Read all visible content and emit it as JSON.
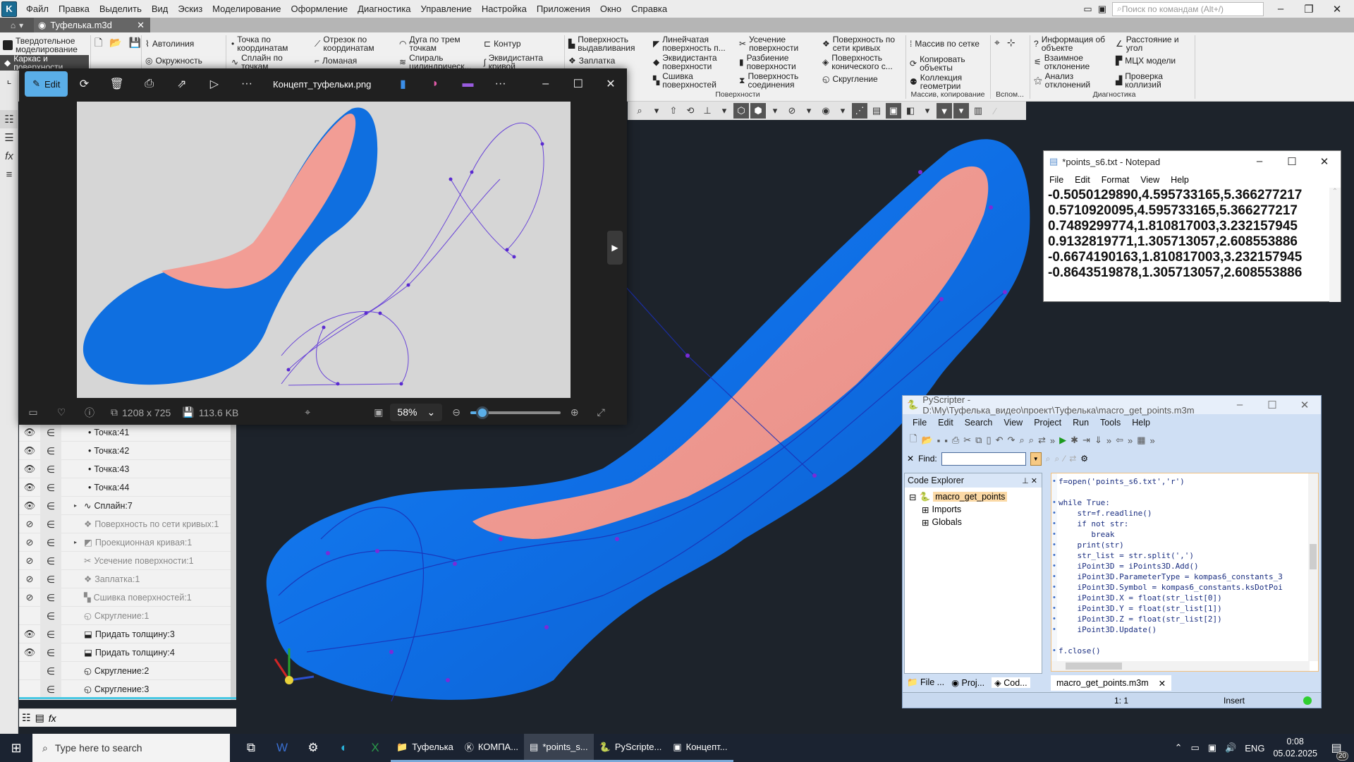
{
  "kompas": {
    "menu": [
      "Файл",
      "Правка",
      "Выделить",
      "Вид",
      "Эскиз",
      "Моделирование",
      "Оформление",
      "Диагностика",
      "Управление",
      "Настройка",
      "Приложения",
      "Окно",
      "Справка"
    ],
    "search_placeholder": "Поиск по командам (Alt+/)",
    "document_tab": "Туфелька.m3d",
    "modes": {
      "solid": "Твердотельное моделирование",
      "surface": "Каркас и поверхности"
    },
    "ribbon": {
      "sketch_tools": [
        "Автолиния",
        "Окружность",
        "Точка по координатам",
        "Сплайн по точкам",
        "Отрезок по координатам",
        "Ломаная",
        "Дуга по трем точкам",
        "Спираль цилиндрическ...",
        "Контур",
        "Эквидистанта кривой"
      ],
      "surface_tools": [
        "Поверхность выдавливания",
        "Заплатка",
        "Линейчатая поверхность п...",
        "Эквидистанта поверхности",
        "Сшивка поверхностей",
        "Усечение поверхности",
        "Разбиение поверхности",
        "Поверхность соединения",
        "Поверхность по сети кривых",
        "Поверхность конического с...",
        "Скругление"
      ],
      "array_tools": [
        "Массив по сетке",
        "Копировать объекты",
        "Коллекция геометрии"
      ],
      "diag_tools": [
        "Информация об объекте",
        "Взаимное отклонение",
        "Анализ отклонений",
        "Расстояние и угол",
        "МЦХ модели",
        "Проверка коллизий"
      ],
      "groups": [
        "Поверхности",
        "Массив, копирование",
        "Вспом...",
        "Диагностика"
      ]
    },
    "tree": [
      {
        "eye": true,
        "label": "Точка:41",
        "dim": false,
        "expand": false,
        "icon": "point"
      },
      {
        "eye": true,
        "label": "Точка:42",
        "dim": false,
        "expand": false,
        "icon": "point"
      },
      {
        "eye": true,
        "label": "Точка:43",
        "dim": false,
        "expand": false,
        "icon": "point"
      },
      {
        "eye": true,
        "label": "Точка:44",
        "dim": false,
        "expand": false,
        "icon": "point"
      },
      {
        "eye": true,
        "label": "Сплайн:7",
        "dim": false,
        "expand": true,
        "icon": "spline"
      },
      {
        "eye": false,
        "label": "Поверхность по сети кривых:1",
        "dim": true,
        "expand": false,
        "icon": "surface"
      },
      {
        "eye": false,
        "label": "Проекционная кривая:1",
        "dim": true,
        "expand": true,
        "icon": "projection"
      },
      {
        "eye": false,
        "label": "Усечение поверхности:1",
        "dim": true,
        "expand": false,
        "icon": "trim"
      },
      {
        "eye": false,
        "label": "Заплатка:1",
        "dim": true,
        "expand": false,
        "icon": "patch"
      },
      {
        "eye": false,
        "label": "Сшивка поверхностей:1",
        "dim": true,
        "expand": false,
        "icon": "stitch"
      },
      {
        "eye": null,
        "label": "Скругление:1",
        "dim": true,
        "expand": false,
        "icon": "fillet"
      },
      {
        "eye": true,
        "label": "Придать толщину:3",
        "dim": false,
        "expand": false,
        "icon": "thicken"
      },
      {
        "eye": true,
        "label": "Придать толщину:4",
        "dim": false,
        "expand": false,
        "icon": "thicken"
      },
      {
        "eye": null,
        "label": "Скругление:2",
        "dim": false,
        "expand": false,
        "icon": "fillet"
      },
      {
        "eye": null,
        "label": "Скругление:3",
        "dim": false,
        "expand": false,
        "icon": "fillet"
      }
    ]
  },
  "photos": {
    "edit_label": "Edit",
    "filename": "Концепт_туфельки.png",
    "dimensions": "1208 x 725",
    "filesize": "113.6 KB",
    "zoom": "58%",
    "zoom_fraction": 0.05
  },
  "notepad": {
    "title": "*points_s6.txt - Notepad",
    "menu": [
      "File",
      "Edit",
      "Format",
      "View",
      "Help"
    ],
    "lines": [
      "-0.5050129890,4.595733165,5.366277217",
      "0.5710920095,4.595733165,5.366277217",
      "0.7489299774,1.810817003,3.232157945",
      "0.9132819771,1.305713057,2.608553886",
      "-0.6674190163,1.810817003,3.232157945",
      "-0.8643519878,1.305713057,2.608553886"
    ]
  },
  "pyscripter": {
    "title": "PyScripter - D:\\My\\Туфелька_видео\\проект\\Туфелька\\macro_get_points.m3m",
    "menu": [
      "File",
      "Edit",
      "Search",
      "View",
      "Project",
      "Run",
      "Tools",
      "Help"
    ],
    "find_label": "Find:",
    "code_explorer": {
      "header": "Code Explorer",
      "root": "macro_get_points",
      "children": [
        "Imports",
        "Globals"
      ]
    },
    "code": [
      "f=open('points_s6.txt','r')",
      "",
      "while True:",
      "    str=f.readline()",
      "    if not str:",
      "       break",
      "    print(str)",
      "    str_list = str.split(',')",
      "    iPoint3D = iPoints3D.Add()",
      "    iPoint3D.ParameterType = kompas6_constants_3",
      "    iPoint3D.Symbol = kompas6_constants.ksDotPoi",
      "    iPoint3D.X = float(str_list[0])",
      "    iPoint3D.Y = float(str_list[1])",
      "    iPoint3D.Z = float(str_list[2])",
      "    iPoint3D.Update()",
      "",
      "f.close()"
    ],
    "bottom_tabs": [
      "File ...",
      "Proj...",
      "Cod..."
    ],
    "file_tab": "macro_get_points.m3m",
    "status_pos": "1: 1",
    "status_mode": "Insert"
  },
  "taskbar": {
    "search_placeholder": "Type here to search",
    "apps": [
      {
        "label": "Туфелька",
        "icon": "folder-icon",
        "active": false
      },
      {
        "label": "КОМПА...",
        "icon": "kompas-icon",
        "active": false
      },
      {
        "label": "*points_s...",
        "icon": "notepad-icon",
        "active": true
      },
      {
        "label": "PyScripte...",
        "icon": "pyscripter-icon",
        "active": false
      },
      {
        "label": "Концепт...",
        "icon": "photos-icon",
        "active": false
      }
    ],
    "lang": "ENG",
    "time": "0:08",
    "date": "05.02.2025",
    "notifications": "20"
  }
}
